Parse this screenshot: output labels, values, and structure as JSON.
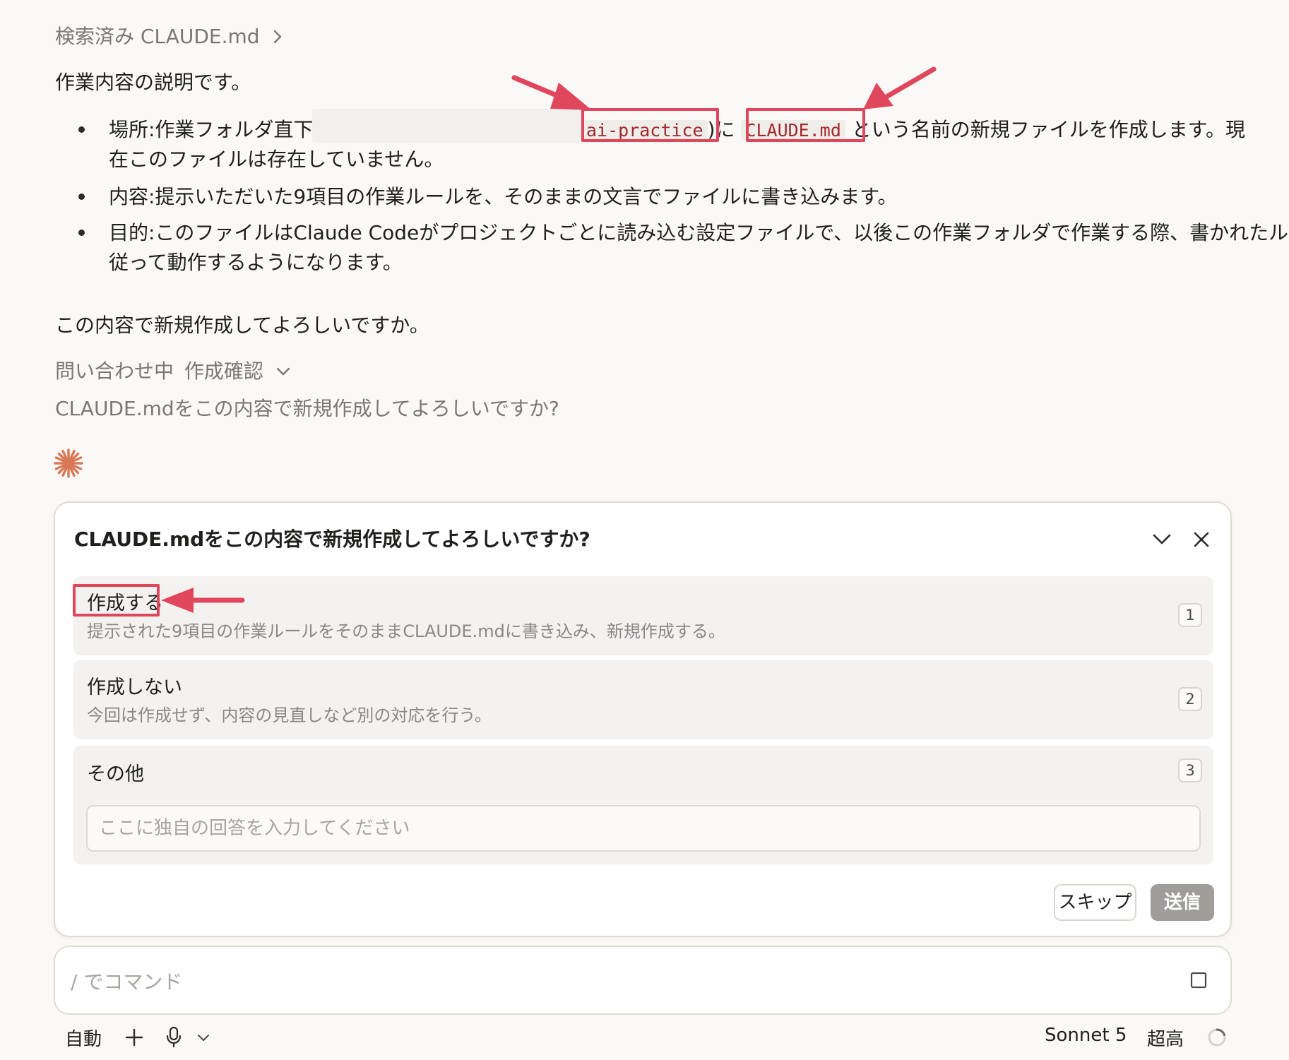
{
  "header": {
    "searched_label": "検索済み CLAUDE.md",
    "chevron": "chevron-right-icon"
  },
  "message": {
    "intro": "作業内容の説明です。",
    "bullet1_prefix": "場所:作業フォルダ直下(",
    "bullet1_folder": "ai-practice",
    "bullet1_mid": ")に",
    "bullet1_file": "CLAUDE.md",
    "bullet1_suffix": "という名前の新規ファイルを作成します。現",
    "bullet1_line2": "在このファイルは存在していません。",
    "bullet2": "内容:提示いただいた9項目の作業ルールを、そのままの文言でファイルに書き込みます。",
    "bullet3_line1": "目的:このファイルはClaude Codeがプロジェクトごとに読み込む設定ファイルで、以後この作業フォルダで作業する際、書かれたルールに",
    "bullet3_line2": "従って動作するようになります。",
    "confirm": "この内容で新規作成してよろしいですか。"
  },
  "inquiry": {
    "status": "問い合わせ中",
    "topic": "作成確認",
    "question": "CLAUDE.mdをこの内容で新規作成してよろしいですか?"
  },
  "colors": {
    "accent": "#d97757",
    "annotation": "#e0465c",
    "code": "#a3282f"
  },
  "card": {
    "title": "CLAUDE.mdをこの内容で新規作成してよろしいですか?",
    "options": [
      {
        "label": "作成する",
        "description": "提示された9項目の作業ルールをそのままCLAUDE.mdに書き込み、新規作成する。",
        "number": "1"
      },
      {
        "label": "作成しない",
        "description": "今回は作成せず、内容の見直しなど別の対応を行う。",
        "number": "2"
      },
      {
        "label": "その他",
        "number": "3",
        "placeholder": "ここに独自の回答を入力してください"
      }
    ],
    "skip_label": "スキップ",
    "send_label": "送信"
  },
  "command": {
    "placeholder": "/ でコマンド"
  },
  "footer": {
    "mode": "自動",
    "model": "Sonnet 5",
    "effort": "超高"
  }
}
